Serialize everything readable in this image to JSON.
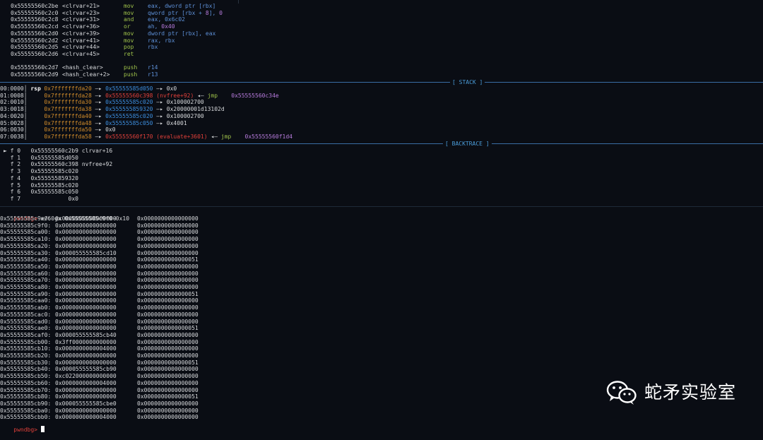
{
  "disasm": [
    {
      "addr": "0x55555560c2be",
      "sym": "<clrvar+21>",
      "mnem": "mov",
      "ops": [
        {
          "t": "reg",
          "v": "eax, dword ptr [rbx]"
        }
      ]
    },
    {
      "addr": "0x55555560c2c0",
      "sym": "<clrvar+23>",
      "mnem": "mov",
      "ops": [
        {
          "t": "reg",
          "v": "qword ptr [rbx + "
        },
        {
          "t": "num",
          "v": "8"
        },
        {
          "t": "reg",
          "v": "], "
        },
        {
          "t": "num",
          "v": "0"
        }
      ]
    },
    {
      "addr": "0x55555560c2c8",
      "sym": "<clrvar+31>",
      "mnem": "and",
      "ops": [
        {
          "t": "reg",
          "v": "eax, 0x6c02"
        }
      ]
    },
    {
      "addr": "0x55555560c2cd",
      "sym": "<clrvar+36>",
      "mnem": "or",
      "ops": [
        {
          "t": "reg",
          "v": "ah, "
        },
        {
          "t": "num",
          "v": "0x40"
        }
      ]
    },
    {
      "addr": "0x55555560c2d0",
      "sym": "<clrvar+39>",
      "mnem": "mov",
      "ops": [
        {
          "t": "reg",
          "v": "dword ptr [rbx], eax"
        }
      ]
    },
    {
      "addr": "0x55555560c2d2",
      "sym": "<clrvar+41>",
      "mnem": "mov",
      "ops": [
        {
          "t": "reg",
          "v": "rax, rbx"
        }
      ]
    },
    {
      "addr": "0x55555560c2d5",
      "sym": "<clrvar+44>",
      "mnem": "pop",
      "ops": [
        {
          "t": "reg",
          "v": "rbx"
        }
      ]
    },
    {
      "addr": "0x55555560c2d6",
      "sym": "<clrvar+45>",
      "mnem": "ret",
      "ops": []
    },
    {
      "addr": "",
      "sym": "",
      "mnem": "",
      "ops": []
    },
    {
      "addr": "0x55555560c2d7",
      "sym": "<hash_clear>",
      "mnem": "push",
      "ops": [
        {
          "t": "reg",
          "v": "r14"
        }
      ]
    },
    {
      "addr": "0x55555560c2d9",
      "sym": "<hash_clear+2>",
      "mnem": "push",
      "ops": [
        {
          "t": "reg",
          "v": "r13"
        }
      ]
    }
  ],
  "stack_label": "[ STACK ]",
  "stack": [
    {
      "off": "00:0000",
      "reg": "rsp",
      "addr": "0x7fffffffda20",
      "chain": [
        {
          "t": "heap",
          "v": "0x55555585d050"
        },
        {
          "t": "val",
          "v": "0x0"
        }
      ],
      "jmp": "",
      "target": ""
    },
    {
      "off": "01:0008",
      "reg": "",
      "addr": "0x7fffffffda28",
      "chain": [
        {
          "t": "code",
          "v": "0x55555560c398 (nvfree+92)"
        }
      ],
      "jmp": "jmp",
      "target": "0x55555560c34e"
    },
    {
      "off": "02:0010",
      "reg": "",
      "addr": "0x7fffffffda30",
      "chain": [
        {
          "t": "heap",
          "v": "0x55555585c020"
        },
        {
          "t": "val",
          "v": "0x100002700"
        }
      ],
      "jmp": "",
      "target": ""
    },
    {
      "off": "03:0018",
      "reg": "",
      "addr": "0x7fffffffda38",
      "chain": [
        {
          "t": "heap",
          "v": "0x555555859320"
        },
        {
          "t": "val",
          "v": "0x20000001d13102d"
        }
      ],
      "jmp": "",
      "target": ""
    },
    {
      "off": "04:0020",
      "reg": "",
      "addr": "0x7fffffffda40",
      "chain": [
        {
          "t": "heap",
          "v": "0x55555585c020"
        },
        {
          "t": "val",
          "v": "0x100002700"
        }
      ],
      "jmp": "",
      "target": ""
    },
    {
      "off": "05:0028",
      "reg": "",
      "addr": "0x7fffffffda48",
      "chain": [
        {
          "t": "heap",
          "v": "0x55555585c050"
        },
        {
          "t": "val",
          "v": "0x4001"
        }
      ],
      "jmp": "",
      "target": ""
    },
    {
      "off": "06:0030",
      "reg": "",
      "addr": "0x7fffffffda50",
      "chain": [
        {
          "t": "val",
          "v": "0x0"
        }
      ],
      "jmp": "",
      "target": ""
    },
    {
      "off": "07:0038",
      "reg": "",
      "addr": "0x7fffffffda58",
      "chain": [
        {
          "t": "code",
          "v": "0x55555560f170 (evaluate+3601)"
        }
      ],
      "jmp": "jmp",
      "target": "0x55555560f1d4"
    }
  ],
  "backtrace_label": "[ BACKTRACE ]",
  "backtrace": [
    {
      "marker": "►",
      "frame": "f 0",
      "addr": "0x55555560c2b9",
      "sym": "clrvar+16"
    },
    {
      "marker": "",
      "frame": "f 1",
      "addr": "0x55555585d050",
      "sym": ""
    },
    {
      "marker": "",
      "frame": "f 2",
      "addr": "0x55555560c398",
      "sym": "nvfree+92"
    },
    {
      "marker": "",
      "frame": "f 3",
      "addr": "0x55555585c020",
      "sym": ""
    },
    {
      "marker": "",
      "frame": "f 4",
      "addr": "0x555555859320",
      "sym": ""
    },
    {
      "marker": "",
      "frame": "f 5",
      "addr": "0x55555585c020",
      "sym": ""
    },
    {
      "marker": "",
      "frame": "f 6",
      "addr": "0x55555585c050",
      "sym": ""
    },
    {
      "marker": "",
      "frame": "f 7",
      "addr": "           0x0",
      "sym": ""
    }
  ],
  "prompt": "pwndbg>",
  "command": " x/60gx 0x55555585c9f0-0x10",
  "memory": [
    [
      "0x55555585c9e0:",
      "0x0000000000000000",
      "0x0000000000000000"
    ],
    [
      "0x55555585c9f0:",
      "0x0000000000000000",
      "0x0000000000000000"
    ],
    [
      "0x55555585ca00:",
      "0x0000000000000000",
      "0x0000000000000000"
    ],
    [
      "0x55555585ca10:",
      "0x0000000000000000",
      "0x0000000000000000"
    ],
    [
      "0x55555585ca20:",
      "0x0000000000000000",
      "0x0000000000000000"
    ],
    [
      "0x55555585ca30:",
      "0x000055555585cd10",
      "0x0000000000000000"
    ],
    [
      "0x55555585ca40:",
      "0x0000000000000000",
      "0x0000000000000051"
    ],
    [
      "0x55555585ca50:",
      "0x0000000000000000",
      "0x0000000000000000"
    ],
    [
      "0x55555585ca60:",
      "0x0000000000000000",
      "0x0000000000000000"
    ],
    [
      "0x55555585ca70:",
      "0x0000000000000000",
      "0x0000000000000000"
    ],
    [
      "0x55555585ca80:",
      "0x0000000000000000",
      "0x0000000000000000"
    ],
    [
      "0x55555585ca90:",
      "0x0000000000000000",
      "0x0000000000000051"
    ],
    [
      "0x55555585caa0:",
      "0x0000000000000000",
      "0x0000000000000000"
    ],
    [
      "0x55555585cab0:",
      "0x0000000000000000",
      "0x0000000000000000"
    ],
    [
      "0x55555585cac0:",
      "0x0000000000000000",
      "0x0000000000000000"
    ],
    [
      "0x55555585cad0:",
      "0x0000000000000000",
      "0x0000000000000000"
    ],
    [
      "0x55555585cae0:",
      "0x0000000000000000",
      "0x0000000000000051"
    ],
    [
      "0x55555585caf0:",
      "0x000055555585cb40",
      "0x0000000000000000"
    ],
    [
      "0x55555585cb00:",
      "0x3ff0000000000000",
      "0x0000000000000000"
    ],
    [
      "0x55555585cb10:",
      "0x0000000000004000",
      "0x0000000000000000"
    ],
    [
      "0x55555585cb20:",
      "0x0000000000000000",
      "0x0000000000000000"
    ],
    [
      "0x55555585cb30:",
      "0x0000000000000000",
      "0x0000000000000051"
    ],
    [
      "0x55555585cb40:",
      "0x000055555585cb90",
      "0x0000000000000000"
    ],
    [
      "0x55555585cb50:",
      "0xc022000000000000",
      "0x0000000000000000"
    ],
    [
      "0x55555585cb60:",
      "0x0000000000004000",
      "0x0000000000000000"
    ],
    [
      "0x55555585cb70:",
      "0x0000000000000000",
      "0x0000000000000000"
    ],
    [
      "0x55555585cb80:",
      "0x0000000000000000",
      "0x0000000000000051"
    ],
    [
      "0x55555585cb90:",
      "0x000055555585cbe0",
      "0x0000000000000000"
    ],
    [
      "0x55555585cba0:",
      "0x0000000000000000",
      "0x0000000000000000"
    ],
    [
      "0x55555585cbb0:",
      "0x0000000000004000",
      "0x0000000000000000"
    ]
  ],
  "watermark": {
    "text": "蛇矛实验室",
    "icon": "wechat-icon"
  }
}
